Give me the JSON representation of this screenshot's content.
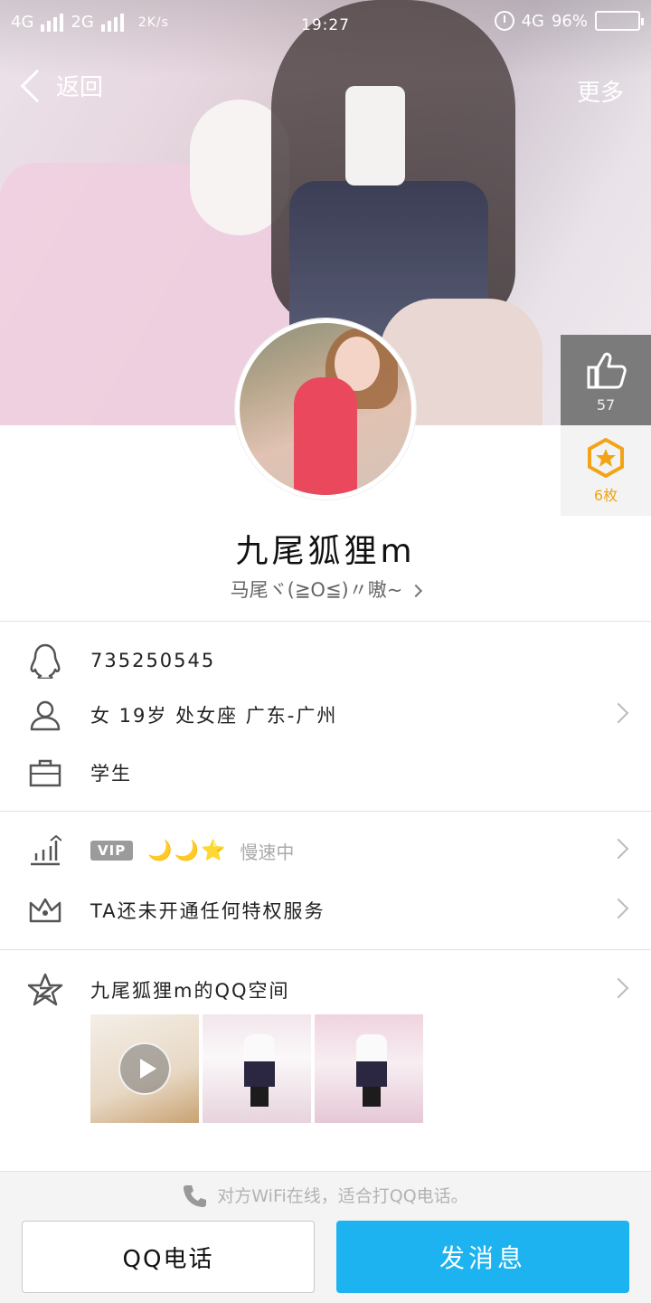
{
  "status_bar": {
    "network1": "4G",
    "network2": "2G",
    "speed": "2K/s",
    "time": "19:27",
    "network3": "4G",
    "battery": "96%"
  },
  "nav": {
    "back_label": "返回",
    "more_label": "更多"
  },
  "side": {
    "likes": "57",
    "medals": "6枚"
  },
  "profile": {
    "nickname": "九尾狐狸m",
    "signature": "马尾ヾ(≧O≦)〃嗷~"
  },
  "info": {
    "qq_number": "735250545",
    "basic": "女  19岁  处女座  广东-广州",
    "occupation": "学生"
  },
  "privileges": {
    "vip_badge": "VIP",
    "levels": "🌙🌙⭐",
    "speed_status": "慢速中",
    "privilege_text": "TA还未开通任何特权服务"
  },
  "qzone": {
    "title": "九尾狐狸m的QQ空间"
  },
  "bottom": {
    "wifi_tip": "对方WiFi在线，适合打QQ电话。",
    "call_button": "QQ电话",
    "message_button": "发消息"
  },
  "colors": {
    "accent": "#1db3f0",
    "medal": "#f2a416",
    "like_bg": "#7b7b7b"
  }
}
